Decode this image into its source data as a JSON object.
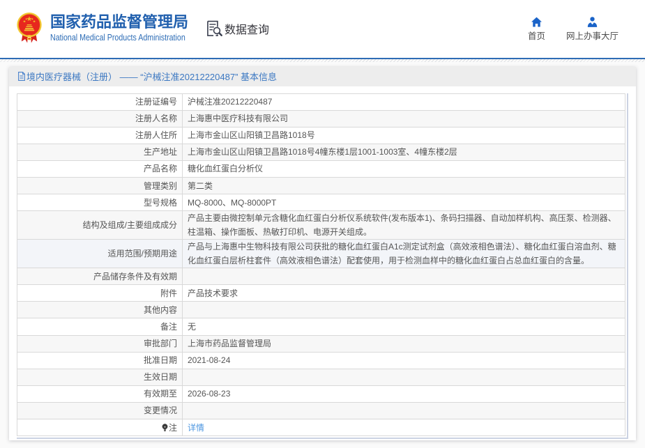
{
  "header": {
    "agency_name_cn": "国家药品监督管理局",
    "agency_name_en": "National Medical Products Administration",
    "section_title": "数据查询",
    "quick_links": [
      {
        "icon": "home-icon",
        "label": "首页"
      },
      {
        "icon": "user-icon",
        "label": "网上办事大厅"
      }
    ]
  },
  "panel": {
    "title": "境内医疗器械（注册） —— “沪械注准20212220487” 基本信息"
  },
  "detail_table": {
    "rows": [
      {
        "label": "注册证编号",
        "value": "沪械注准20212220487"
      },
      {
        "label": "注册人名称",
        "value": "上海惠中医疗科技有限公司"
      },
      {
        "label": "注册人住所",
        "value": "上海市金山区山阳镇卫昌路1018号"
      },
      {
        "label": "生产地址",
        "value": "上海市金山区山阳镇卫昌路1018号4幢东楼1层1001-1003室、4幢东楼2层"
      },
      {
        "label": "产品名称",
        "value": "糖化血红蛋白分析仪"
      },
      {
        "label": "管理类别",
        "value": "第二类"
      },
      {
        "label": "型号规格",
        "value": "MQ-8000、MQ-8000PT"
      },
      {
        "label": "结构及组成/主要组成成分",
        "value": "产品主要由微控制单元含糖化血红蛋白分析仪系统软件(发布版本1)、条码扫描器、自动加样机构、高压泵、检测器、柱温箱、操作面板、热敏打印机、电源开关组成。"
      },
      {
        "label": "适用范围/预期用途",
        "value": "产品与上海惠中生物科技有限公司获批的糖化血红蛋白A1c测定试剂盒（高效液相色谱法）、糖化血红蛋白溶血剂、糖化血红蛋白层析柱套件（高效液相色谱法）配套使用，用于检测血样中的糖化血红蛋白占总血红蛋白的含量。",
        "highlighted": true
      },
      {
        "label": "产品储存条件及有效期",
        "value": ""
      },
      {
        "label": "附件",
        "value": "产品技术要求"
      },
      {
        "label": "其他内容",
        "value": ""
      },
      {
        "label": "备注",
        "value": "无"
      },
      {
        "label": "审批部门",
        "value": "上海市药品监督管理局"
      },
      {
        "label": "批准日期",
        "value": "2021-08-24"
      },
      {
        "label": "生效日期",
        "value": ""
      },
      {
        "label": "有效期至",
        "value": "2026-08-23"
      },
      {
        "label": "变更情况",
        "value": ""
      },
      {
        "label": "注",
        "value": "详情",
        "value_is_link": true,
        "label_icon": "bulb-icon"
      }
    ]
  },
  "colors": {
    "brand_blue": "#2160ae",
    "icon_blue": "#1a63c8",
    "rule_blue": "#2e6cb5",
    "panel_title_blue": "#3c78c2",
    "link_blue": "#4d96e0",
    "body_text": "#555555",
    "title_bar_bg": "#ededed",
    "row_alt_bg": "#f7f7f7",
    "row_highlight_bg": "#f3f5f9",
    "table_border": "#d9d9d9",
    "table_outer_border": "#ccd3e3",
    "emblem_red": "#de2a20",
    "emblem_gold": "#f5c831"
  }
}
